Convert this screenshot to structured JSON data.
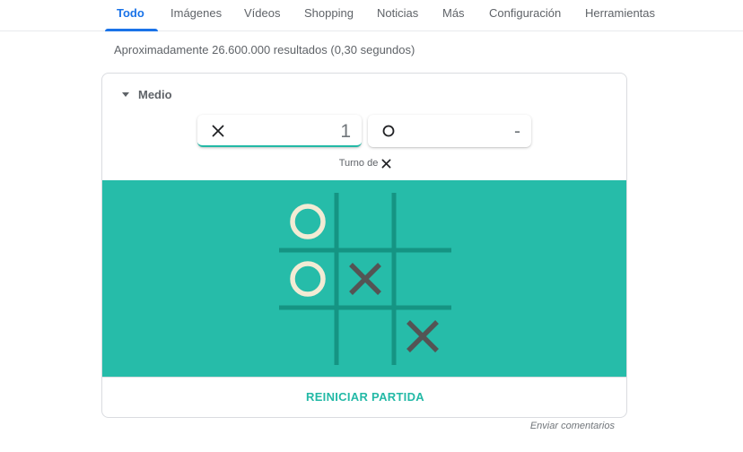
{
  "tabs": [
    {
      "label": "Todo",
      "active": true
    },
    {
      "label": "Imágenes"
    },
    {
      "label": "Vídeos"
    },
    {
      "label": "Shopping"
    },
    {
      "label": "Noticias"
    },
    {
      "label": "Más"
    },
    {
      "label": "Configuración"
    },
    {
      "label": "Herramientas"
    }
  ],
  "results_stats": "Aproximadamente 26.600.000 resultados (0,30 segundos)",
  "game": {
    "difficulty": "Medio",
    "score_x": "1",
    "score_o": "-",
    "turn_label": "Turno de",
    "turn_player": "X",
    "board": [
      [
        "O",
        "",
        ""
      ],
      [
        "O",
        "X",
        ""
      ],
      [
        "",
        "",
        "X"
      ]
    ],
    "reset_label": "REINICIAR PARTIDA",
    "colors": {
      "board_bg": "#26bca9",
      "grid_lines": "#159483",
      "o_mark": "#f2ebd4",
      "x_mark": "#545454",
      "accent": "#23b9a6"
    }
  },
  "feedback_label": "Enviar comentarios"
}
